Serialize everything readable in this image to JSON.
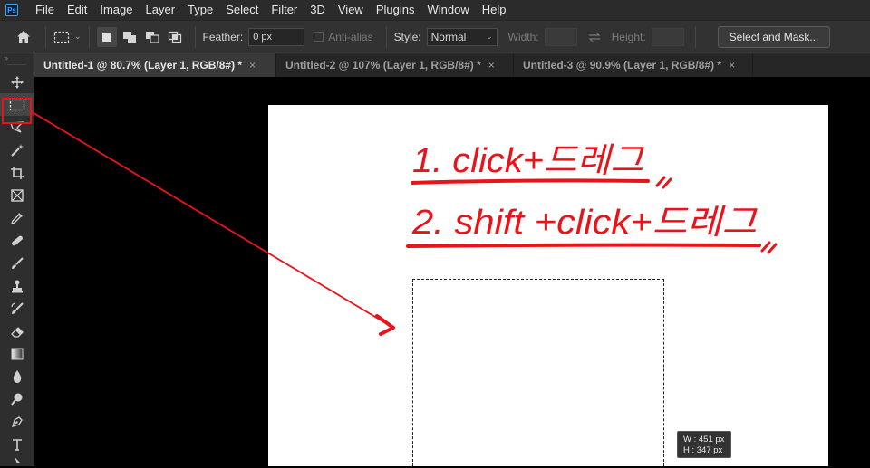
{
  "app": {
    "logo_text": "Ps"
  },
  "menu": [
    "File",
    "Edit",
    "Image",
    "Layer",
    "Type",
    "Select",
    "Filter",
    "3D",
    "View",
    "Plugins",
    "Window",
    "Help"
  ],
  "options": {
    "feather_label": "Feather:",
    "feather_value": "0 px",
    "antialias_label": "Anti-alias",
    "style_label": "Style:",
    "style_value": "Normal",
    "width_label": "Width:",
    "height_label": "Height:",
    "select_mask_label": "Select and Mask..."
  },
  "tabs": [
    {
      "label": "Untitled-1 @ 80.7% (Layer 1, RGB/8#) *",
      "close": "×"
    },
    {
      "label": "Untitled-2 @ 107% (Layer 1, RGB/8#) *",
      "close": "×"
    },
    {
      "label": "Untitled-3 @ 90.9% (Layer 1, RGB/8#) *",
      "close": "×"
    }
  ],
  "toolbar": {
    "collapse": "»"
  },
  "canvas": {
    "annotation_line1": "1. click+드레그",
    "annotation_line2": "2. shift +click+드레그",
    "annotation_color": "#e8141a"
  },
  "size_tooltip": {
    "width": "W : 451 px",
    "height": "H : 347 px"
  },
  "colors": {
    "accent": "#31a8ff",
    "highlight": "#e8141a",
    "canvas": "#ffffff"
  }
}
